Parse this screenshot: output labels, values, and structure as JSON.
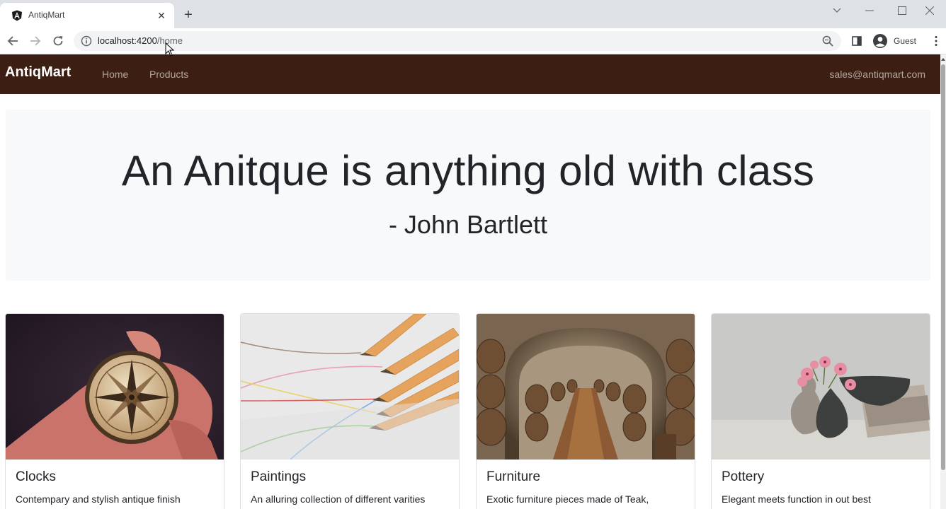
{
  "browser": {
    "tab_title": "AntiqMart",
    "url_host": "localhost:4200",
    "url_path": "/home",
    "profile_name": "Guest"
  },
  "navbar": {
    "brand": "AntiqMart",
    "links": [
      "Home",
      "Products"
    ],
    "email": "sales@antiqmart.com",
    "background": "#3c1e12"
  },
  "hero": {
    "title": "An Anitque is anything old with class",
    "author": "- John Bartlett"
  },
  "cards": [
    {
      "title": "Clocks",
      "text": "Contempary and stylish antique finish"
    },
    {
      "title": "Paintings",
      "text": "An alluring collection of different varities"
    },
    {
      "title": "Furniture",
      "text": "Exotic furniture pieces made of Teak,"
    },
    {
      "title": "Pottery",
      "text": "Elegant meets function in out best"
    }
  ]
}
